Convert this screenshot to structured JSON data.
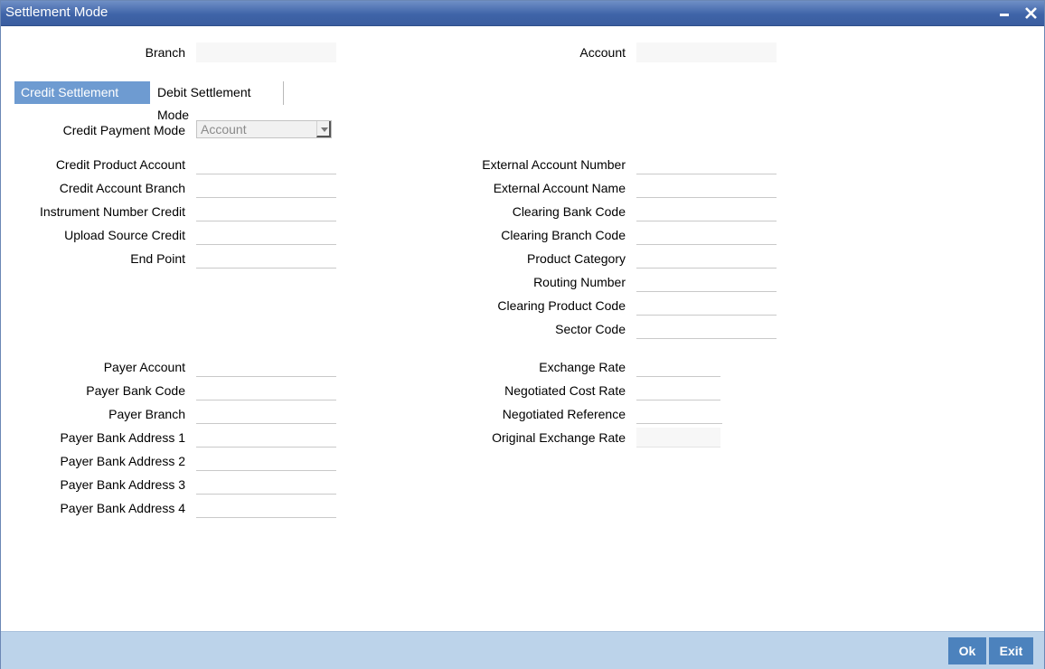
{
  "window": {
    "title": "Settlement Mode",
    "minimize_icon": "minimize-icon",
    "close_icon": "close-icon"
  },
  "header": {
    "branch_label": "Branch",
    "branch_value": "",
    "account_label": "Account",
    "account_value": ""
  },
  "tabs": [
    {
      "label": "Credit Settlement Mode",
      "active": true
    },
    {
      "label": "Debit Settlement Mode",
      "active": false
    }
  ],
  "credit_payment_mode": {
    "label": "Credit Payment Mode",
    "value": "Account",
    "options_icon": "chevron-down-icon"
  },
  "left_fields": [
    {
      "label": "Credit Product Account",
      "value": ""
    },
    {
      "label": "Credit Account Branch",
      "value": ""
    },
    {
      "label": "Instrument Number Credit",
      "value": ""
    },
    {
      "label": "Upload Source Credit",
      "value": ""
    },
    {
      "label": "End Point",
      "value": ""
    }
  ],
  "right_fields": [
    {
      "label": "External Account Number",
      "value": ""
    },
    {
      "label": "External Account Name",
      "value": ""
    },
    {
      "label": "Clearing Bank Code",
      "value": ""
    },
    {
      "label": "Clearing Branch Code",
      "value": ""
    },
    {
      "label": "Product Category",
      "value": ""
    },
    {
      "label": "Routing Number",
      "value": ""
    },
    {
      "label": "Clearing Product Code",
      "value": ""
    },
    {
      "label": "Sector Code",
      "value": ""
    }
  ],
  "payer_fields": [
    {
      "label": "Payer Account",
      "value": ""
    },
    {
      "label": "Payer Bank Code",
      "value": ""
    },
    {
      "label": "Payer Branch",
      "value": ""
    },
    {
      "label": "Payer Bank Address 1",
      "value": ""
    },
    {
      "label": "Payer Bank Address 2",
      "value": ""
    },
    {
      "label": "Payer Bank Address 3",
      "value": ""
    },
    {
      "label": "Payer Bank Address 4",
      "value": ""
    }
  ],
  "rate_fields": [
    {
      "label": "Exchange Rate",
      "value": ""
    },
    {
      "label": "Negotiated Cost Rate",
      "value": ""
    },
    {
      "label": "Negotiated Reference",
      "value": ""
    },
    {
      "label": "Original Exchange Rate",
      "value": ""
    }
  ],
  "footer": {
    "ok_label": "Ok",
    "exit_label": "Exit"
  },
  "colors": {
    "title_bar": "#3f64a8",
    "active_tab": "#6e9bd1",
    "footer": "#bcd3ea",
    "button": "#4c82bd"
  }
}
